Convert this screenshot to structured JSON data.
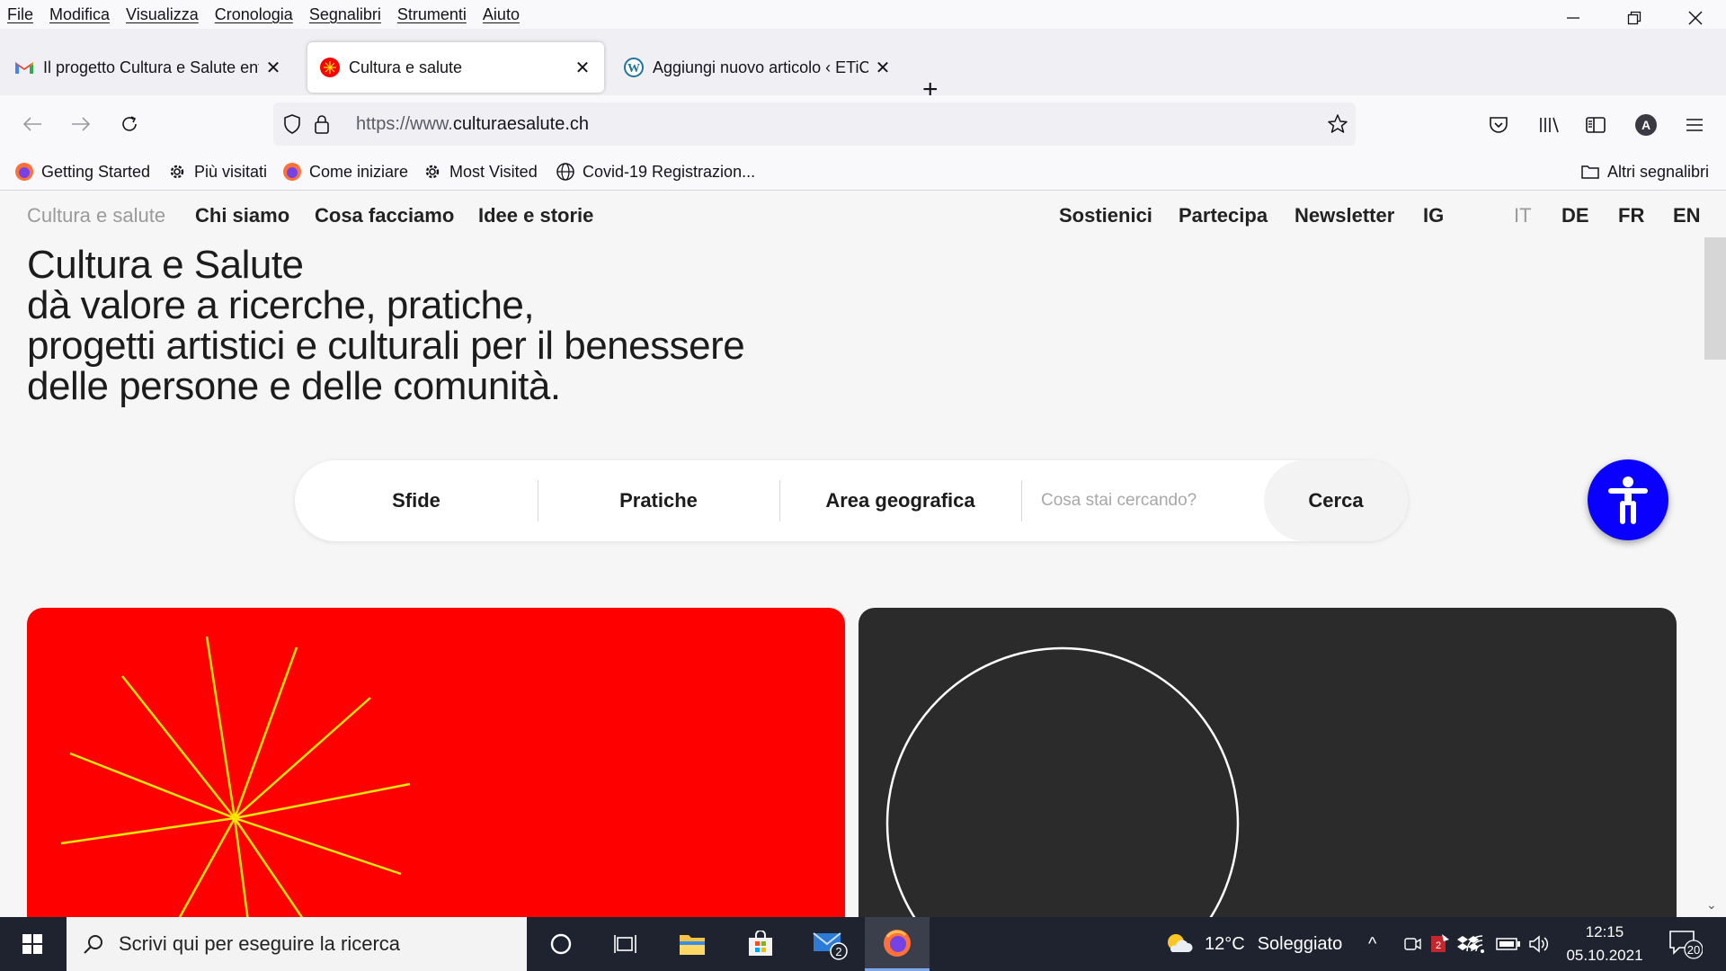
{
  "menubar": {
    "items": [
      "File",
      "Modifica",
      "Visualizza",
      "Cronologia",
      "Segnalibri",
      "Strumenti",
      "Aiuto"
    ]
  },
  "tabs": [
    {
      "title": "Il progetto Cultura e Salute entra",
      "favicon": "gmail-icon",
      "active": false
    },
    {
      "title": "Cultura e salute",
      "favicon": "cultura-salute-icon",
      "active": true
    },
    {
      "title": "Aggiungi nuovo articolo ‹ ETiCin",
      "favicon": "wordpress-icon",
      "active": false
    }
  ],
  "navbar": {
    "url_prefix": "https://www.",
    "url_domain": "culturaesalute.ch"
  },
  "bookmarks": {
    "items": [
      {
        "label": "Getting Started",
        "icon": "firefox-icon"
      },
      {
        "label": "Più visitati",
        "icon": "gear-icon"
      },
      {
        "label": "Come iniziare",
        "icon": "firefox-icon"
      },
      {
        "label": "Most Visited",
        "icon": "gear-icon"
      },
      {
        "label": "Covid-19 Registrazion...",
        "icon": "globe-icon"
      }
    ],
    "other": "Altri segnalibri"
  },
  "site": {
    "nav_left": [
      "Cultura e salute",
      "Chi siamo",
      "Cosa facciamo",
      "Idee e storie"
    ],
    "nav_right": [
      "Sostienici",
      "Partecipa",
      "Newsletter",
      "IG"
    ],
    "languages": [
      "IT",
      "DE",
      "FR",
      "EN"
    ],
    "headline": [
      "Cultura e Salute",
      "dà valore a ricerche, pratiche,",
      "progetti artistici e culturali per il benessere",
      "delle persone e delle comunità."
    ],
    "search": {
      "filters": [
        "Sfide",
        "Pratiche",
        "Area geografica"
      ],
      "placeholder": "Cosa stai cercando?",
      "button": "Cerca"
    },
    "colors": {
      "red_card": "#ff0000",
      "dark_card": "#2b2b2b",
      "accessibility": "#0a00ff",
      "rays": "#ffe600"
    }
  },
  "taskbar": {
    "search_placeholder": "Scrivi qui per eseguire la ricerca",
    "weather_temp": "12°C",
    "weather_desc": "Soleggiato",
    "time": "12:15",
    "date": "05.10.2021",
    "mail_badge": "2",
    "notifications": "20"
  }
}
